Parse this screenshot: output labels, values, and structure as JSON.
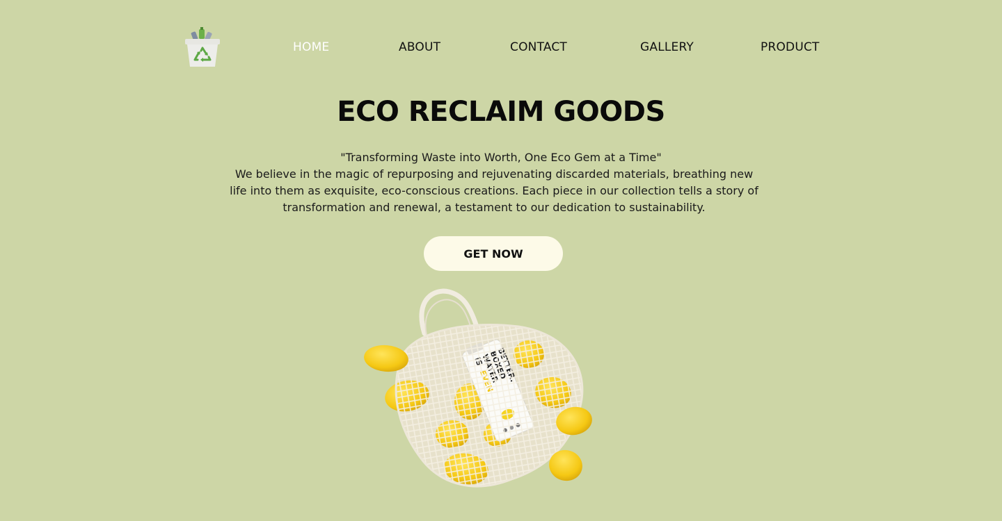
{
  "logo": {
    "icon": "recycling-bin-icon"
  },
  "nav": {
    "items": [
      {
        "label": "HOME",
        "active": true
      },
      {
        "label": "ABOUT",
        "active": false
      },
      {
        "label": "CONTACT",
        "active": false
      },
      {
        "label": "GALLERY",
        "active": false
      },
      {
        "label": "PRODUCT",
        "active": false
      }
    ]
  },
  "hero": {
    "title": "ECO RECLAIM GOODS",
    "tagline": "\"Transforming Waste into Worth, One Eco Gem at a Time\"",
    "description": "We believe in the magic of repurposing and rejuvenating discarded materials, breathing new life into them as exquisite, eco-conscious creations. Each piece in our collection tells a story of transformation and renewal, a testament to our dedication to sustainability.",
    "cta_label": "GET NOW",
    "image": {
      "name": "mesh-bag-lemons-image",
      "carton_text": [
        "BOXED",
        "WATER",
        "IS",
        "EVEN",
        "BETTER."
      ]
    }
  },
  "colors": {
    "background": "#cdd6a6",
    "cta_background": "#fdfae8",
    "nav_active": "#ffffff",
    "text": "#111111",
    "lemon": "#f5c814"
  }
}
